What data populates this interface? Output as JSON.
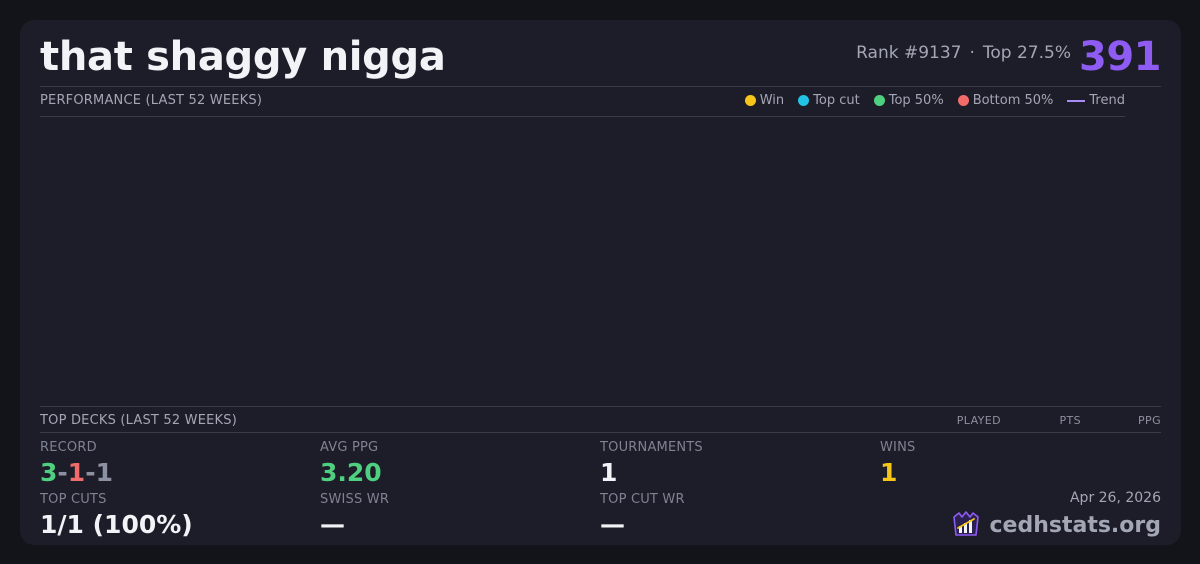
{
  "header": {
    "player_name": "that shaggy nigga",
    "rank": "Rank #9137",
    "separator": "·",
    "top_percent": "Top 27.5%",
    "score": "391"
  },
  "performance": {
    "label": "PERFORMANCE (LAST 52 WEEKS)",
    "legend": [
      {
        "label": "Win",
        "color": "#f5c518",
        "shape": "dot"
      },
      {
        "label": "Top cut",
        "color": "#22c3e6",
        "shape": "dot"
      },
      {
        "label": "Top 50%",
        "color": "#4fd080",
        "shape": "dot"
      },
      {
        "label": "Bottom 50%",
        "color": "#f26b6b",
        "shape": "dot"
      },
      {
        "label": "Trend",
        "color": "#a98bf5",
        "shape": "line"
      }
    ]
  },
  "top_decks": {
    "label": "TOP DECKS (LAST 52 WEEKS)",
    "columns": [
      "PLAYED",
      "PTS",
      "PPG"
    ]
  },
  "stats": {
    "record": {
      "label": "RECORD",
      "wins": "3",
      "losses": "1",
      "draws": "1",
      "sep": "-"
    },
    "avg_ppg": {
      "label": "AVG PPG",
      "value": "3.20"
    },
    "tournaments": {
      "label": "TOURNAMENTS",
      "value": "1"
    },
    "wins": {
      "label": "WINS",
      "value": "1"
    },
    "top_cuts": {
      "label": "TOP CUTS",
      "value": "1/1 (100%)"
    },
    "swiss_wr": {
      "label": "SWISS WR",
      "value": "—"
    },
    "top_cut_wr": {
      "label": "TOP CUT WR",
      "value": "—"
    }
  },
  "footer": {
    "date": "Apr 26, 2026",
    "brand": "cedhstats.org",
    "logo_icon": "cedhstats-logo-icon"
  },
  "colors": {
    "background": "#131419",
    "card": "#1c1d28",
    "accent": "#8e5cf2",
    "win": "#f5c518",
    "top_cut": "#22c3e6",
    "top_50": "#4fd080",
    "bottom_50": "#f26b6b"
  }
}
